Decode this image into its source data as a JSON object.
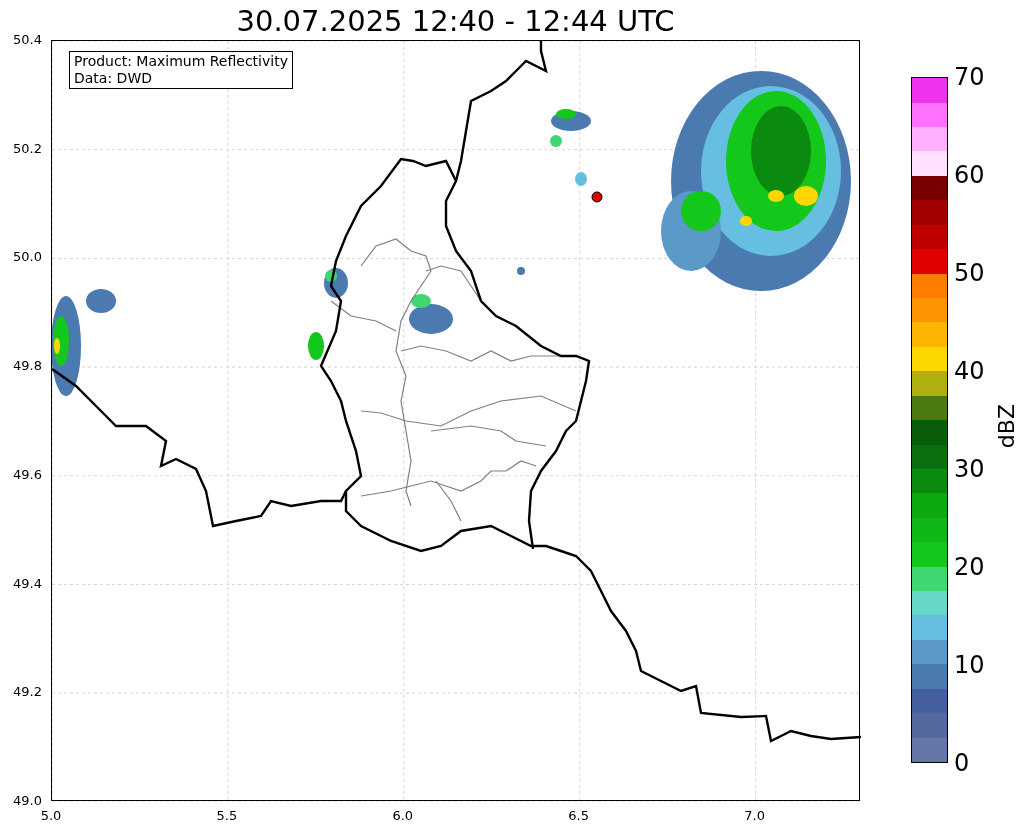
{
  "title": "30.07.2025 12:40 - 12:44 UTC",
  "legend": [
    "Product: Maximum Reflectivity",
    "Data: DWD"
  ],
  "x_ticks": [
    "5.0",
    "5.5",
    "6.0",
    "6.5",
    "7.0"
  ],
  "y_ticks": [
    "50.4",
    "50.2",
    "50.0",
    "49.8",
    "49.6",
    "49.4",
    "49.2",
    "49.0"
  ],
  "colorbar": {
    "label": "dBZ",
    "ticks": [
      "70",
      "60",
      "50",
      "40",
      "30",
      "20",
      "10",
      "0"
    ],
    "segments": [
      {
        "color": "#6577a8"
      },
      {
        "color": "#56699f"
      },
      {
        "color": "#445f9e"
      },
      {
        "color": "#4a7ab0"
      },
      {
        "color": "#5b9ac8"
      },
      {
        "color": "#66bee0"
      },
      {
        "color": "#66d8c8"
      },
      {
        "color": "#3fd870"
      },
      {
        "color": "#13c81a"
      },
      {
        "color": "#10b815"
      },
      {
        "color": "#0ea80f"
      },
      {
        "color": "#0b8a10"
      },
      {
        "color": "#0a700f"
      },
      {
        "color": "#085c0c"
      },
      {
        "color": "#4a7a10"
      },
      {
        "color": "#b0b010"
      },
      {
        "color": "#ffd700"
      },
      {
        "color": "#ffb400"
      },
      {
        "color": "#ff9400"
      },
      {
        "color": "#ff7c00"
      },
      {
        "color": "#e00000"
      },
      {
        "color": "#c00000"
      },
      {
        "color": "#a00000"
      },
      {
        "color": "#780000"
      },
      {
        "color": "#ffe0ff"
      },
      {
        "color": "#ffb0ff"
      },
      {
        "color": "#ff70ff"
      },
      {
        "color": "#ee33ee"
      }
    ]
  }
}
